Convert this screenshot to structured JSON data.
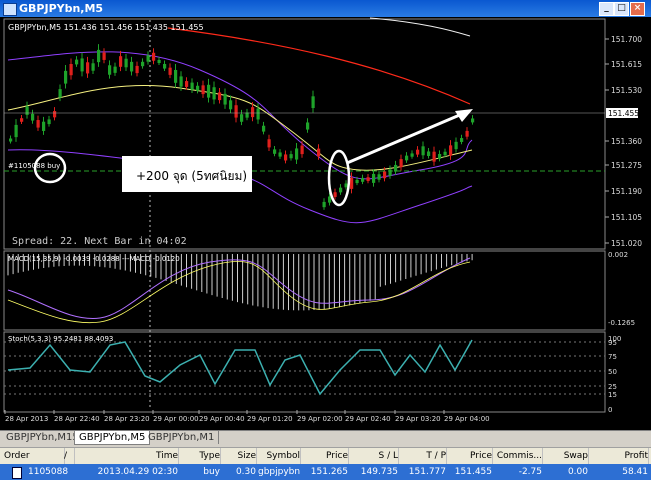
{
  "window": {
    "title": "GBPJPYbn,M5"
  },
  "chart": {
    "header": "GBPJPYbn,M5  151.436 151.456 151.435 151.455",
    "order_line_label": "#1105088 buy",
    "annotation": "+200 จุด (5ทศนิยม)",
    "spread_text": "Spread: 22. Next Bar in 04:02",
    "current_price": "151.455",
    "price_ticks": [
      "151.700",
      "151.615",
      "151.530",
      "151.455",
      "151.360",
      "151.275",
      "151.190",
      "151.105",
      "151.020"
    ],
    "macd": {
      "label": "MACD(15,35,9) -0.0039 -0.0288 ---MACD -0.0120",
      "ticks": [
        "0.002",
        "-0.1265"
      ]
    },
    "stoch": {
      "label": "Stoch(5,3,3) 95.2481 88.4093",
      "ticks": [
        "100",
        "95",
        "75",
        "50",
        "25",
        "15",
        "0"
      ]
    },
    "time_ticks": [
      "28 Apr 2013",
      "28 Apr 22:40",
      "28 Apr 23:20",
      "29 Apr 00:00",
      "29 Apr 00:40",
      "29 Apr 01:20",
      "29 Apr 02:00",
      "29 Apr 02:40",
      "29 Apr 03:20",
      "29 Apr 04:00"
    ],
    "colors": {
      "bull": "#1ea32a",
      "bear": "#e0201c",
      "ma_slow": "#ff2a1a",
      "ma_fast": "#f5f080",
      "band": "#8a2be2",
      "macd_signal": "#b070ff",
      "macd_line": "#ffff66",
      "stoch": "#3cb0b0"
    }
  },
  "tabs": [
    {
      "label": "GBPJPYbn,M15",
      "active": false
    },
    {
      "label": "GBPJPYbn,M5",
      "active": true
    },
    {
      "label": "GBPJPYbn,M1",
      "active": false
    }
  ],
  "trade_table": {
    "headers": [
      "Order",
      "/",
      "Time",
      "Type",
      "Size",
      "Symbol",
      "Price",
      "S / L",
      "T / P",
      "Price",
      "Commis...",
      "Swap",
      "Profit"
    ],
    "row": {
      "order": "1105088",
      "time": "2013.04.29 02:30",
      "type": "buy",
      "size": "0.30",
      "symbol": "gbpjpybn",
      "price": "151.265",
      "sl": "149.735",
      "tp": "151.777",
      "cur_price": "151.455",
      "commission": "-2.75",
      "swap": "0.00",
      "profit": "58.41"
    }
  }
}
